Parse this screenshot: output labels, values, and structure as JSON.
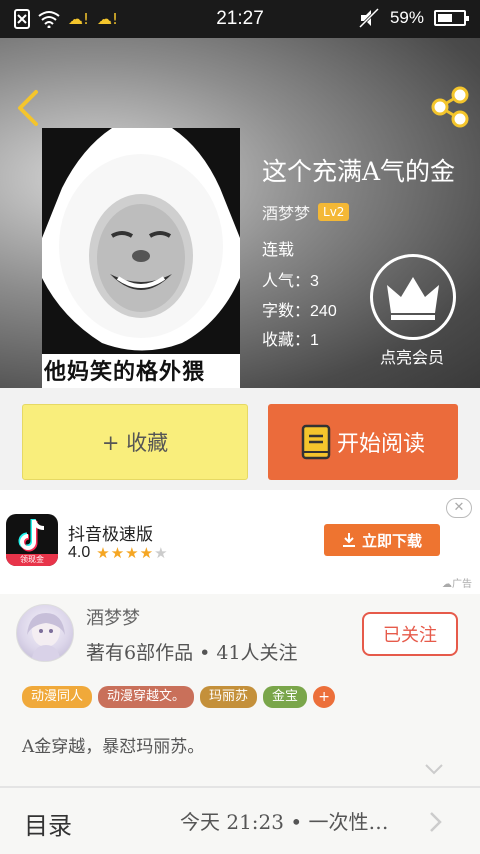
{
  "status_bar": {
    "time": "21:27",
    "battery": "59%",
    "battery_level": 0.59
  },
  "book": {
    "title": "这个充满A气的金",
    "cover_caption": "他妈笑的格外猥",
    "author": "酒梦梦",
    "level": "Lv2",
    "status": "连载",
    "popularity_label": "人气：",
    "popularity": "3",
    "words_label": "字数：",
    "words": "240",
    "favorites_label": "收藏：",
    "favorites": "1",
    "vip_label": "点亮会员"
  },
  "actions": {
    "collect_label": "+ 收藏",
    "read_label": "开始阅读"
  },
  "ad": {
    "app_name": "抖音极速版",
    "rating": "4.0",
    "stars": 4,
    "download_label": "立即下载",
    "close_label": "✕",
    "ad_mark": "广告",
    "logo_badge": "领现金"
  },
  "author_card": {
    "name": "酒梦梦",
    "stats": "著有6部作品 • 41人关注",
    "follow_label": "已关注",
    "tags": [
      {
        "label": "动漫同人",
        "color": "#f0a93a"
      },
      {
        "label": "动漫穿越文。",
        "color": "#c9705a"
      },
      {
        "label": "玛丽苏",
        "color": "#c4903a"
      },
      {
        "label": "金宝",
        "color": "#7aa64a"
      }
    ],
    "add_tag_label": "+",
    "intro": "A金穿越，暴怼玛丽苏。"
  },
  "toc": {
    "label": "目录",
    "info": "今天 21:23  •  一次性…"
  },
  "colors": {
    "accent_orange": "#eb6b3b",
    "collect_yellow": "#f9ee7c",
    "follow_red": "#e65a4a",
    "icon_yellow": "#f4c52c"
  }
}
